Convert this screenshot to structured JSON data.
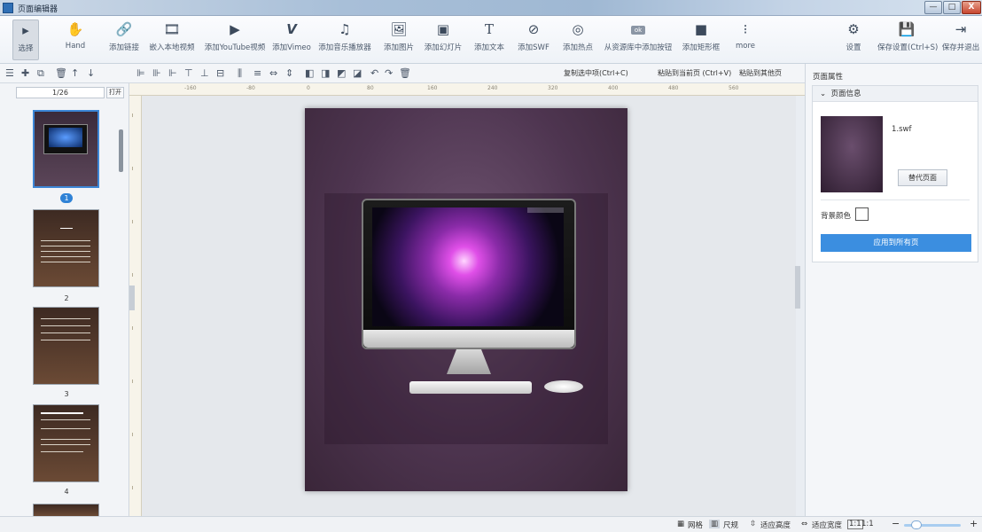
{
  "window": {
    "title": "页面编辑器",
    "minimize": "—",
    "maximize": "□",
    "close": "X"
  },
  "toolbar": {
    "tools": [
      {
        "label": "选择",
        "icon": "▸"
      },
      {
        "label": "Hand",
        "icon": "✋"
      },
      {
        "label": "添加链接",
        "icon": "🔗"
      },
      {
        "label": "嵌入本地视频",
        "icon": "🎞"
      },
      {
        "label": "添加YouTube视频",
        "icon": "▶"
      },
      {
        "label": "添加Vimeo",
        "icon": "V"
      },
      {
        "label": "添加音乐播放器",
        "icon": "♫"
      },
      {
        "label": "添加图片",
        "icon": "🖼"
      },
      {
        "label": "添加幻灯片",
        "icon": "▣"
      },
      {
        "label": "添加文本",
        "icon": "T"
      },
      {
        "label": "添加SWF",
        "icon": "⊘"
      },
      {
        "label": "添加热点",
        "icon": "◎"
      },
      {
        "label": "从资源库中添加按钮",
        "icon": "ok"
      },
      {
        "label": "添加矩形框",
        "icon": "■"
      },
      {
        "label": "more",
        "icon": "⁝"
      },
      {
        "label": "设置",
        "icon": "⚙"
      },
      {
        "label": "保存设置(Ctrl+S)",
        "icon": "💾"
      },
      {
        "label": "保存并退出",
        "icon": "⇥"
      }
    ]
  },
  "subbar": {
    "copy": "复制选中项(Ctrl+C)",
    "paste_current": "粘贴到当前页 (Ctrl+V)",
    "paste_others": "粘贴到其他页"
  },
  "pages": {
    "pager": "1/26",
    "open_button": "打开",
    "thumbnail_numbers": [
      "1",
      "2",
      "3",
      "4"
    ]
  },
  "ruler": {
    "ticks": [
      "-160",
      "-80",
      "0",
      "80",
      "160",
      "240",
      "320",
      "400",
      "480",
      "560"
    ]
  },
  "properties": {
    "panel_title": "页面属性",
    "section_title": "页面信息",
    "file_name": "1.swf",
    "replace_button": "替代页面",
    "bg_color_label": "背景颜色",
    "apply_all_button": "应用到所有页"
  },
  "status": {
    "grid": "网格",
    "ruler": "尺规",
    "fit_height": "适应高度",
    "fit_width": "适应宽度",
    "actual_size": "1:1",
    "zoom_out": "−",
    "zoom_in": "+",
    "zoom_level": 0.15
  },
  "colors": {
    "accent": "#3b8ee0",
    "selected_border": "#3c86d6"
  }
}
